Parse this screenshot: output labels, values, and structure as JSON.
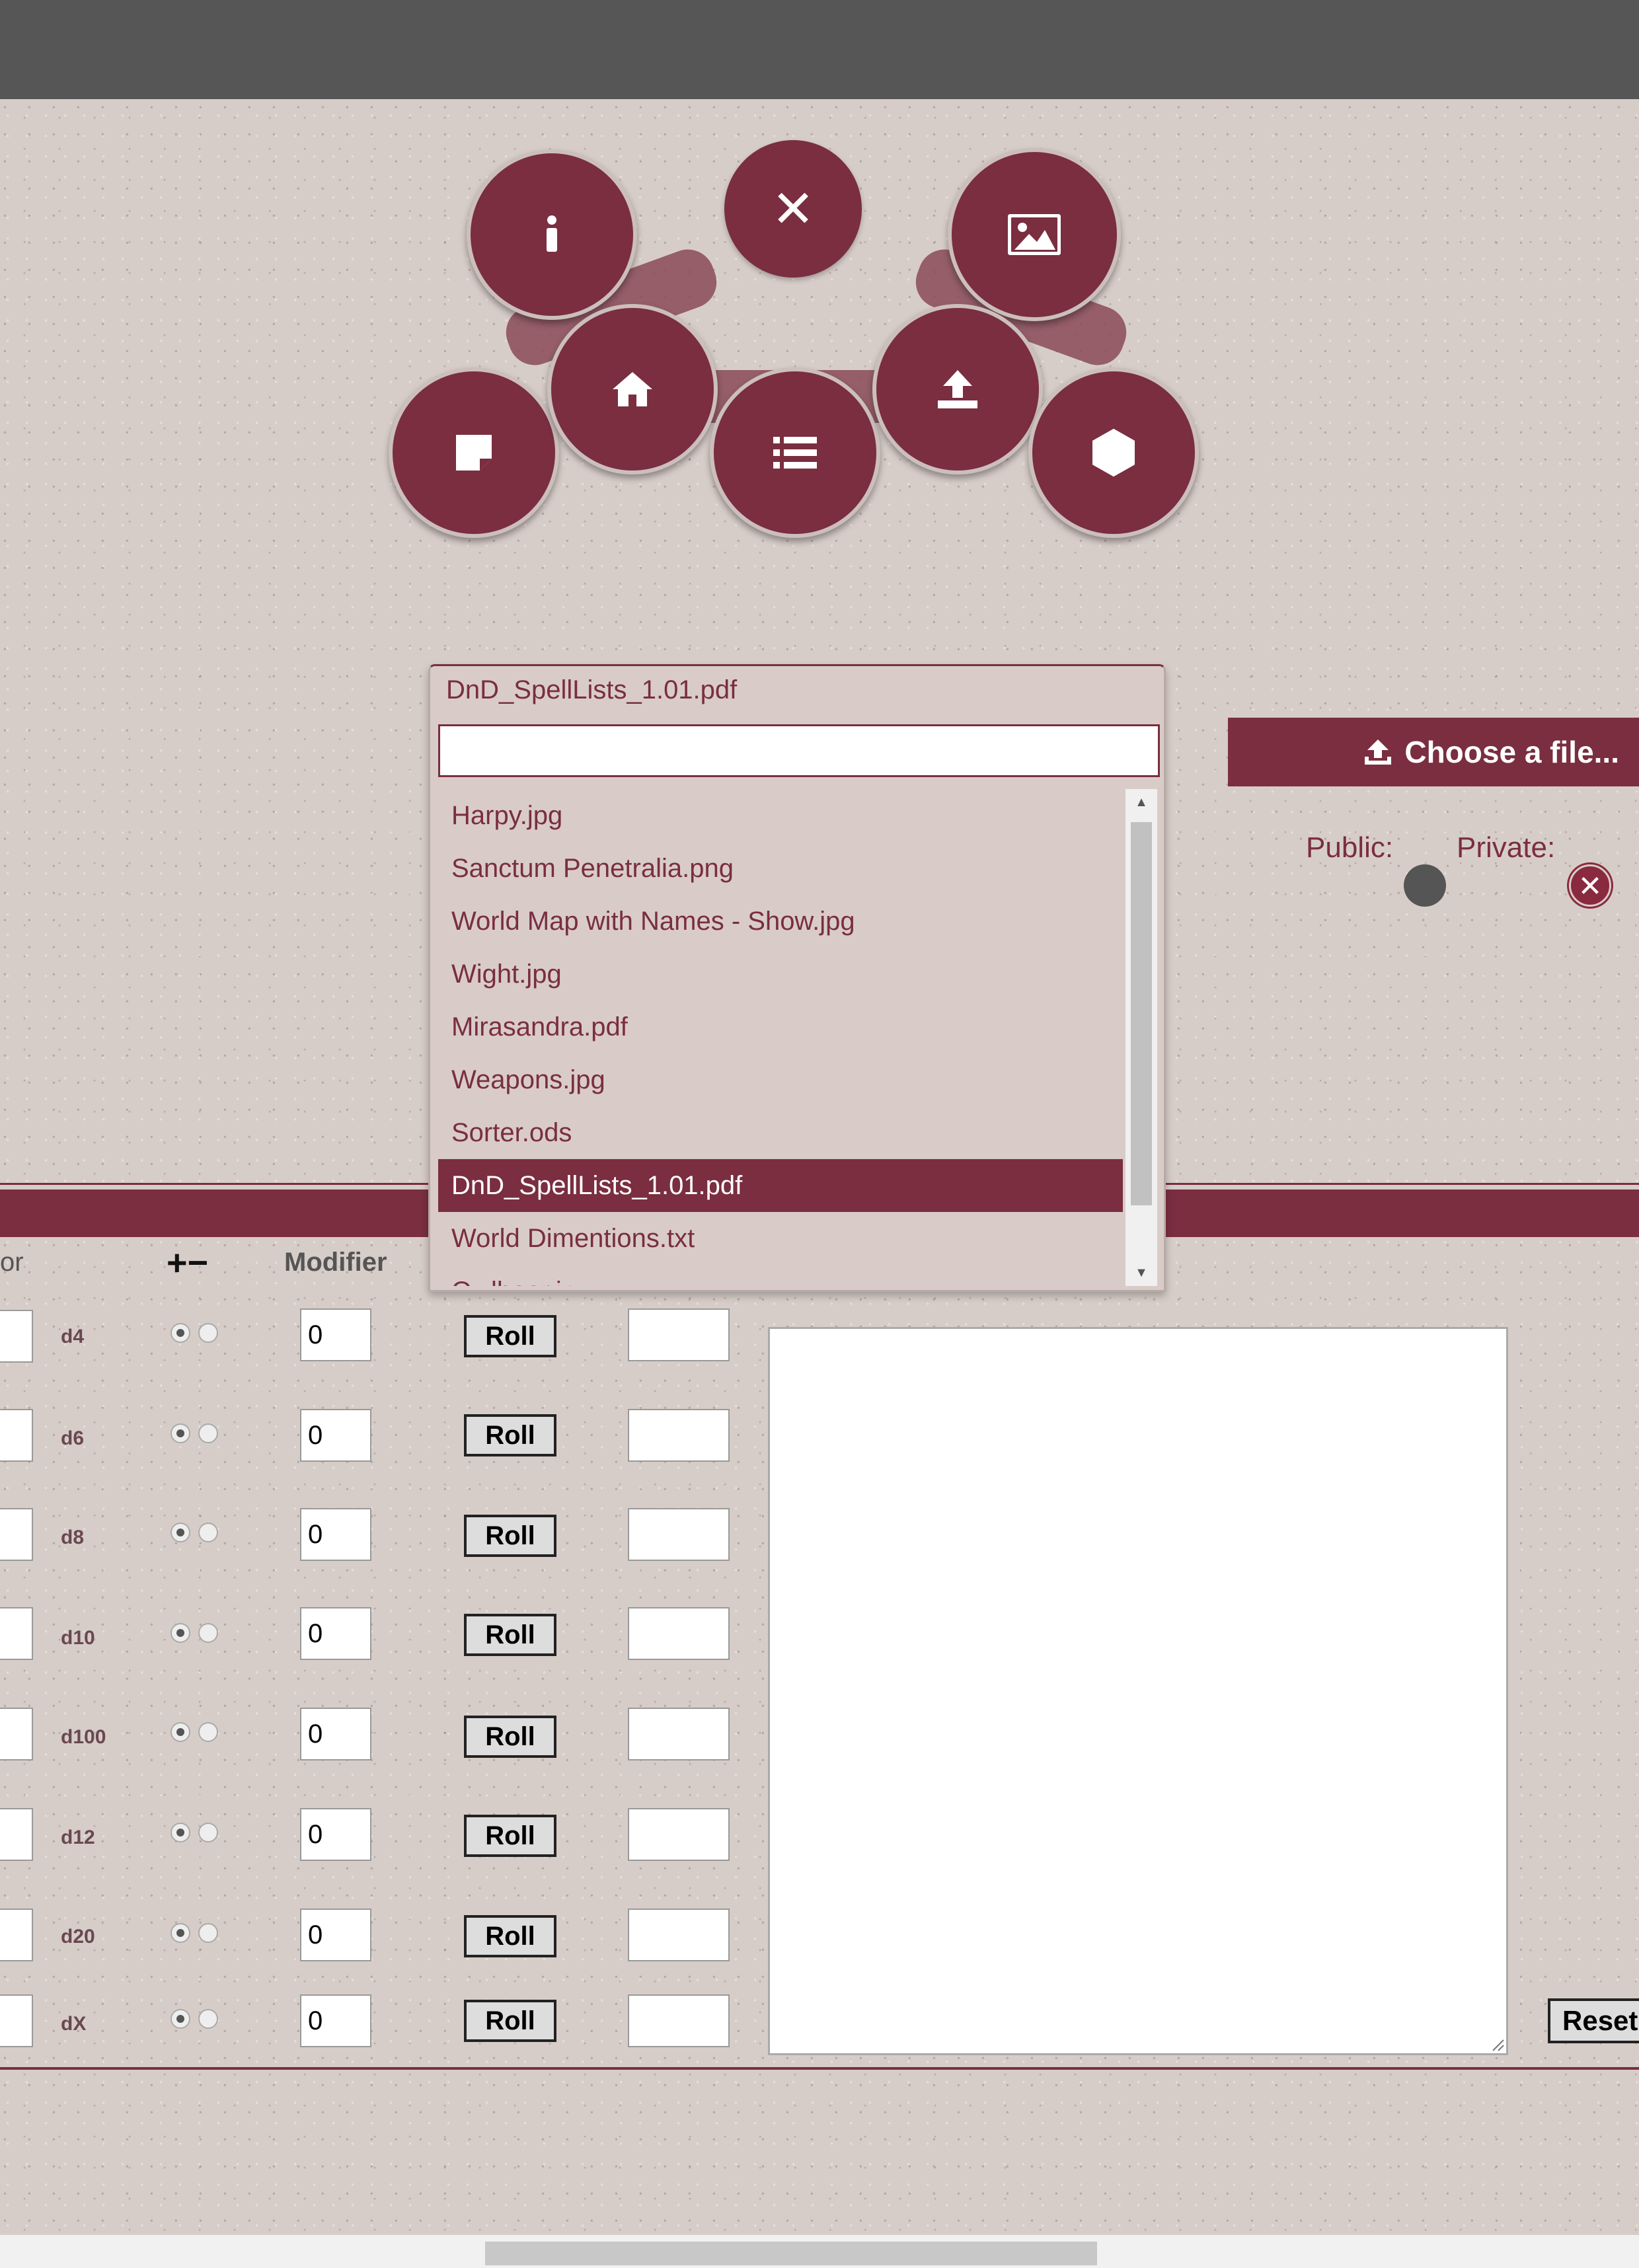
{
  "file_picker": {
    "selected_file": "DnD_SpellLists_1.01.pdf",
    "search_value": "",
    "files": [
      "Harpy.jpg",
      "Sanctum Penetralia.png",
      "World Map with Names - Show.jpg",
      "Wight.jpg",
      "Mirasandra.pdf",
      "Weapons.jpg",
      "Sorter.ods",
      "DnD_SpellLists_1.01.pdf",
      "World Dimentions.txt",
      "Owlbear.jpg"
    ],
    "highlighted_index": 7
  },
  "upload": {
    "choose_label": "Choose a file...",
    "public_label": "Public:",
    "private_label": "Private:",
    "private_icon": "✕"
  },
  "menu": {
    "close_icon": "✕",
    "items": [
      "info-icon",
      "image-icon",
      "note-icon",
      "home-icon",
      "list-icon",
      "upload-icon",
      "dice-icon"
    ]
  },
  "dice": {
    "header_partial": "or",
    "header_plus_minus": "+−",
    "header_modifier": "Modifier",
    "roll_label": "Roll",
    "reset_label": "Reset",
    "rows": [
      {
        "die": "d4",
        "modifier": "0"
      },
      {
        "die": "d6",
        "modifier": "0"
      },
      {
        "die": "d8",
        "modifier": "0"
      },
      {
        "die": "d10",
        "modifier": "0"
      },
      {
        "die": "d100",
        "modifier": "0"
      },
      {
        "die": "d12",
        "modifier": "0"
      },
      {
        "die": "d20",
        "modifier": "0"
      },
      {
        "die": "dX",
        "modifier": "0"
      }
    ]
  },
  "colors": {
    "accent": "#7a2e40",
    "background": "#d7cdc8",
    "topbar": "#565656"
  }
}
